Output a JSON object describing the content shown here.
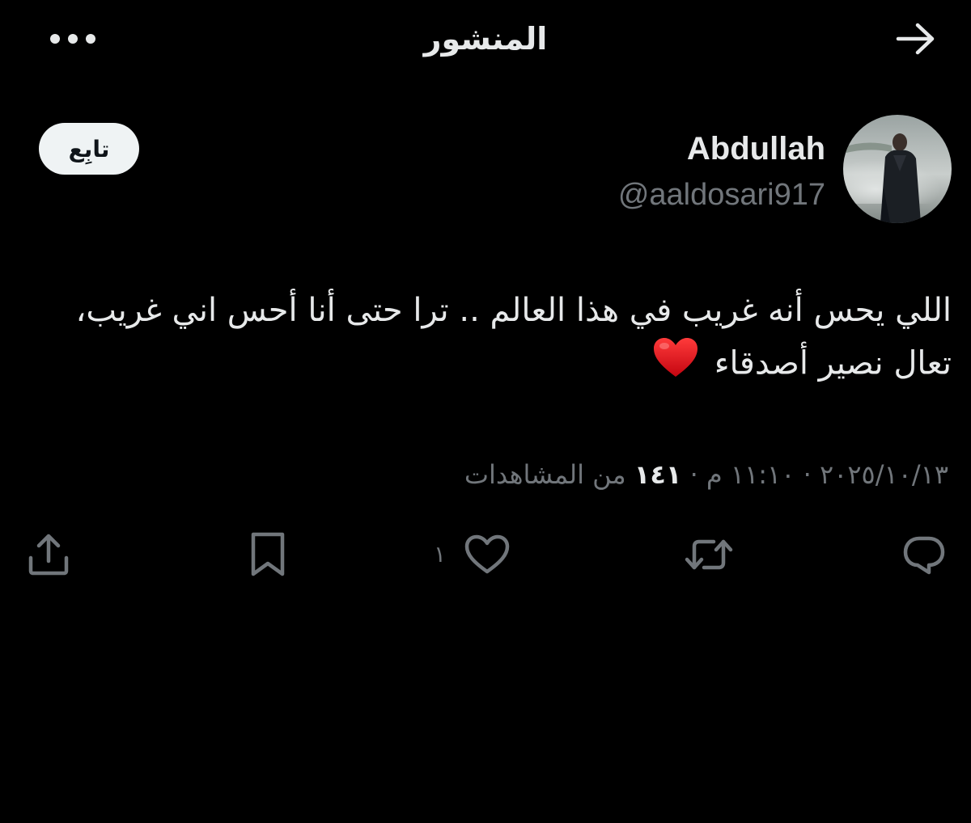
{
  "header": {
    "title": "المنشور",
    "back_icon": "arrow-right-icon",
    "more_icon": "more-horizontal-icon"
  },
  "author": {
    "name": "Abdullah",
    "handle": "@aaldosari917",
    "follow_label": "تابِع"
  },
  "tweet": {
    "text": "اللي يحس أنه غريب في هذا العالم .. ترا حتى أنا أحس اني غريب، تعال نصير أصدقاء",
    "emoji": "red-heart-emoji"
  },
  "meta": {
    "date": "٢٠٢٥/١٠/١٣",
    "time": "١١:١٠ م",
    "separator": "·",
    "views_count": "١٤١",
    "views_label": "من المشاهدات"
  },
  "actions": {
    "reply_icon": "reply-icon",
    "repost_icon": "repost-icon",
    "like_icon": "heart-outline-icon",
    "like_count": "١",
    "bookmark_icon": "bookmark-icon",
    "share_icon": "share-icon"
  },
  "colors": {
    "background": "#000000",
    "primary_text": "#e7e9ea",
    "secondary_text": "#71767b",
    "follow_button_bg": "#eff3f4",
    "follow_button_text": "#0f1419",
    "emoji_heart": "#e0131f"
  }
}
